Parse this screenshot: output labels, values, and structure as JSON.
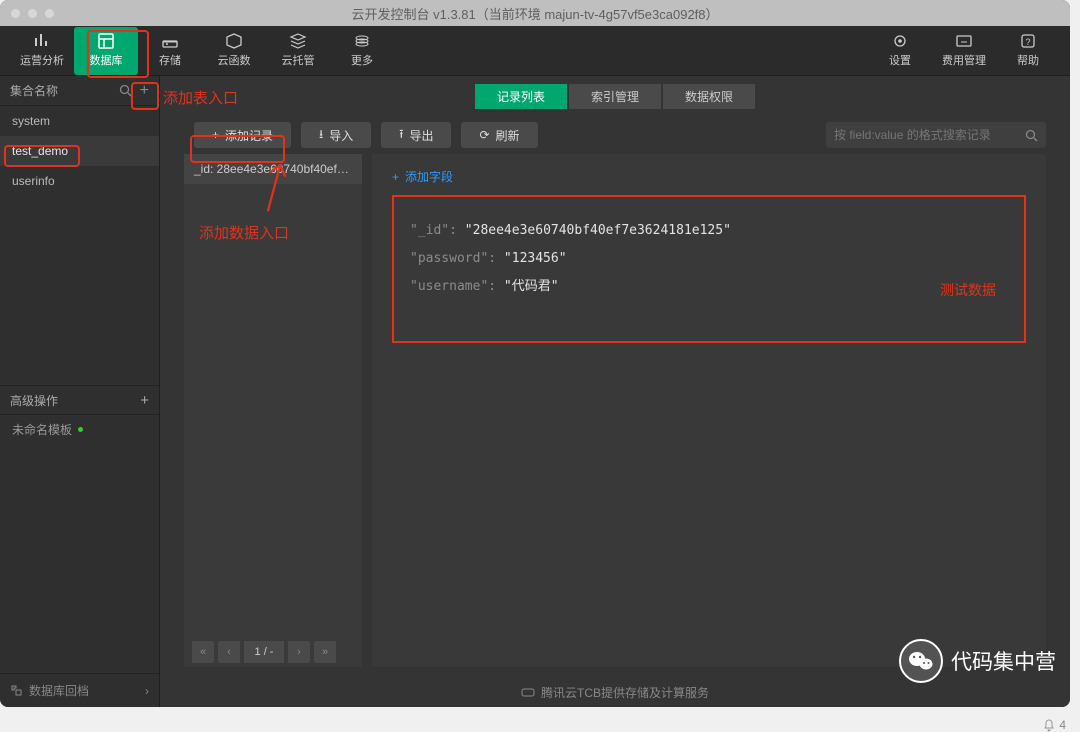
{
  "title": "云开发控制台 v1.3.81（当前环境 majun-tv-4g57vf5e3ca092f8）",
  "toolbar": {
    "left": [
      {
        "label": "运营分析"
      },
      {
        "label": "数据库"
      },
      {
        "label": "存储"
      },
      {
        "label": "云函数"
      },
      {
        "label": "云托管"
      },
      {
        "label": "更多"
      }
    ],
    "right": [
      {
        "label": "设置"
      },
      {
        "label": "费用管理"
      },
      {
        "label": "帮助"
      }
    ]
  },
  "sidebar": {
    "title": "集合名称",
    "items": [
      {
        "name": "system"
      },
      {
        "name": "test_demo"
      },
      {
        "name": "userinfo"
      }
    ],
    "advanced": "高级操作",
    "unnamed": "未命名模板",
    "footer": "数据库回档"
  },
  "tabs": [
    {
      "label": "记录列表"
    },
    {
      "label": "索引管理"
    },
    {
      "label": "数据权限"
    }
  ],
  "actions": {
    "add": "添加记录",
    "import": "导入",
    "export": "导出",
    "refresh": "刷新"
  },
  "search_placeholder": "按 field:value 的格式搜索记录",
  "record_id_short": "_id: 28ee4e3e60740bf40ef7e36...",
  "pager": "1 / -",
  "add_field": "添加字段",
  "doc": {
    "_id_key": "\"_id\":",
    "_id_val": "\"28ee4e3e60740bf40ef7e3624181e125\"",
    "password_key": "\"password\":",
    "password_val": "\"123456\"",
    "username_key": "\"username\":",
    "username_val": "\"代码君\""
  },
  "anno": {
    "add_table": "添加表入口",
    "add_data": "添加数据入口",
    "test_data": "测试数据"
  },
  "footer": "腾讯云TCB提供存储及计算服务",
  "wechat": "代码集中营",
  "bell_count": "4"
}
